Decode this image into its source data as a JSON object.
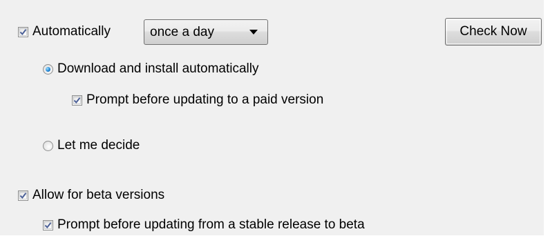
{
  "auto_check": {
    "label": "Automatically",
    "checked": true,
    "frequency": {
      "selected": "once a day"
    }
  },
  "check_now_button": {
    "label": "Check Now"
  },
  "install_options": {
    "download_install": {
      "label": "Download and install automatically",
      "selected": true
    },
    "prompt_paid": {
      "label": "Prompt before updating to a paid version",
      "checked": true
    },
    "let_me_decide": {
      "label": "Let me decide",
      "selected": false
    }
  },
  "beta": {
    "allow": {
      "label": "Allow for beta versions",
      "checked": true
    },
    "prompt_stable_to_beta": {
      "label": "Prompt before updating from a stable release to beta",
      "checked": true
    }
  },
  "colors": {
    "panel_background": "#f0f0f0",
    "check_mark": "#4a5f97",
    "radio_dot": "#1a7fd1"
  },
  "icons": {
    "checkbox_mark": "check-icon",
    "dropdown": "chevron-down-icon"
  }
}
